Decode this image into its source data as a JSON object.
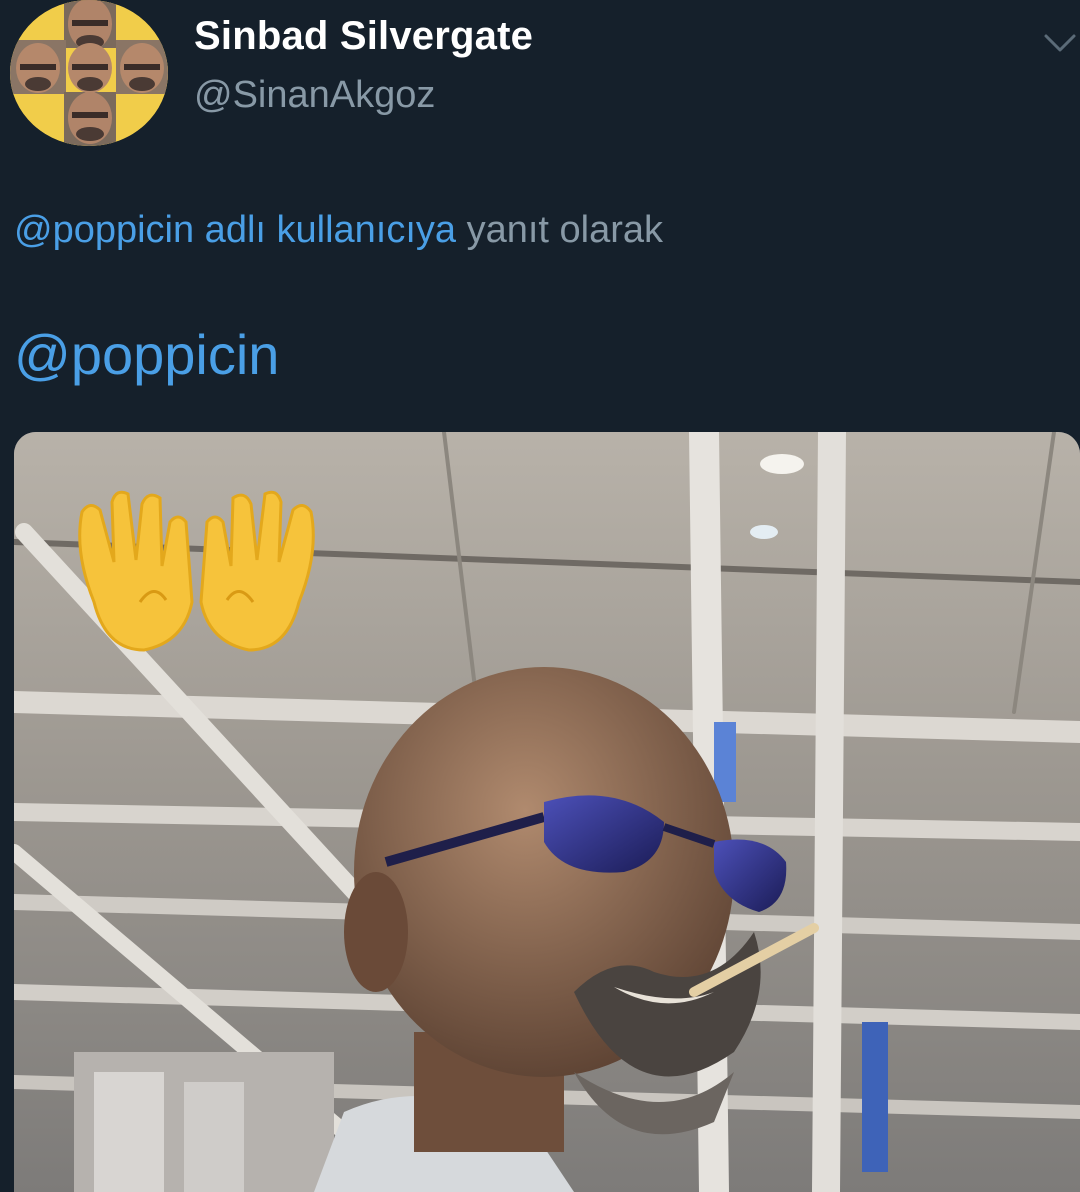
{
  "tweet": {
    "display_name": "Sinbad Silvergate",
    "handle": "@SinanAkgoz",
    "reply_to": {
      "link_text": "@poppicin adlı kullanıcıya",
      "suffix_text": " yanıt olarak"
    },
    "body_mention": "@poppicin",
    "media": {
      "emoji": "open-hands-emoji"
    }
  },
  "colors": {
    "background": "#15202b",
    "link": "#4a9fe6",
    "secondary_text": "#8899a6",
    "primary_text": "#ffffff"
  }
}
